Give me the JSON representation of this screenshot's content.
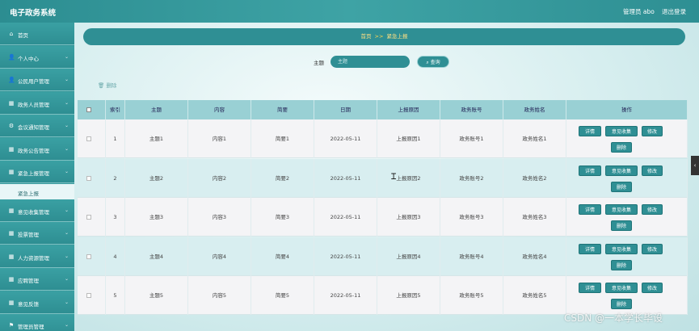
{
  "header": {
    "title": "电子政务系统",
    "admin": "管理员 abo",
    "logout": "退出登录"
  },
  "sidebar": {
    "items": [
      {
        "label": "首页",
        "icon": "home-icon",
        "glyph": "⌂"
      },
      {
        "label": "个人中心",
        "icon": "user-icon",
        "glyph": "👤"
      },
      {
        "label": "公民用户管理",
        "icon": "user-icon",
        "glyph": "👤"
      },
      {
        "label": "政务人员管理",
        "icon": "grid-icon",
        "glyph": "▦"
      },
      {
        "label": "会议通知管理",
        "icon": "gear-icon",
        "glyph": "⚙"
      },
      {
        "label": "政务公告管理",
        "icon": "grid-icon",
        "glyph": "▦"
      },
      {
        "label": "紧急上报管理",
        "icon": "grid-icon",
        "glyph": "▦"
      },
      {
        "label": "意见收集管理",
        "icon": "grid-icon",
        "glyph": "▦"
      },
      {
        "label": "投票管理",
        "icon": "grid-icon",
        "glyph": "▦"
      },
      {
        "label": "人力资源管理",
        "icon": "grid-icon",
        "glyph": "▦"
      },
      {
        "label": "应聘管理",
        "icon": "grid-icon",
        "glyph": "▦"
      },
      {
        "label": "意见反馈",
        "icon": "grid-icon",
        "glyph": "▦"
      },
      {
        "label": "管理员管理",
        "icon": "flag-icon",
        "glyph": "⚑"
      }
    ],
    "active_sub": "紧急上报"
  },
  "breadcrumb": {
    "home": "首页",
    "sep": ">>",
    "current": "紧急上报"
  },
  "search": {
    "label": "主题",
    "placeholder": "主题",
    "button": "查询"
  },
  "toolbar": {
    "delete_label": "删除"
  },
  "table": {
    "columns": [
      "索引",
      "主题",
      "内容",
      "简要",
      "日期",
      "上报原因",
      "政务账号",
      "政务姓名",
      "操作"
    ],
    "rows": [
      {
        "index": "1",
        "topic": "主题1",
        "content": "内容1",
        "summary": "简要1",
        "date": "2022-05-11",
        "reason": "上报原因1",
        "account": "政务账号1",
        "name": "政务姓名1"
      },
      {
        "index": "2",
        "topic": "主题2",
        "content": "内容2",
        "summary": "简要2",
        "date": "2022-05-11",
        "reason": "上报原因2",
        "account": "政务账号2",
        "name": "政务姓名2"
      },
      {
        "index": "3",
        "topic": "主题3",
        "content": "内容3",
        "summary": "简要3",
        "date": "2022-05-11",
        "reason": "上报原因3",
        "account": "政务账号3",
        "name": "政务姓名3"
      },
      {
        "index": "4",
        "topic": "主题4",
        "content": "内容4",
        "summary": "简要4",
        "date": "2022-05-11",
        "reason": "上报原因4",
        "account": "政务账号4",
        "name": "政务姓名4"
      },
      {
        "index": "5",
        "topic": "主题5",
        "content": "内容5",
        "summary": "简要5",
        "date": "2022-05-11",
        "reason": "上报原因5",
        "account": "政务账号5",
        "name": "政务姓名5"
      }
    ],
    "actions": {
      "detail": "详情",
      "collect": "意见收集",
      "edit": "修改",
      "delete": "删除"
    }
  },
  "watermark": "CSDN @一本学长毕设",
  "colors": {
    "accent": "#2f8f94",
    "header_row": "#99d0d4",
    "crumb_text": "#ffe082"
  }
}
